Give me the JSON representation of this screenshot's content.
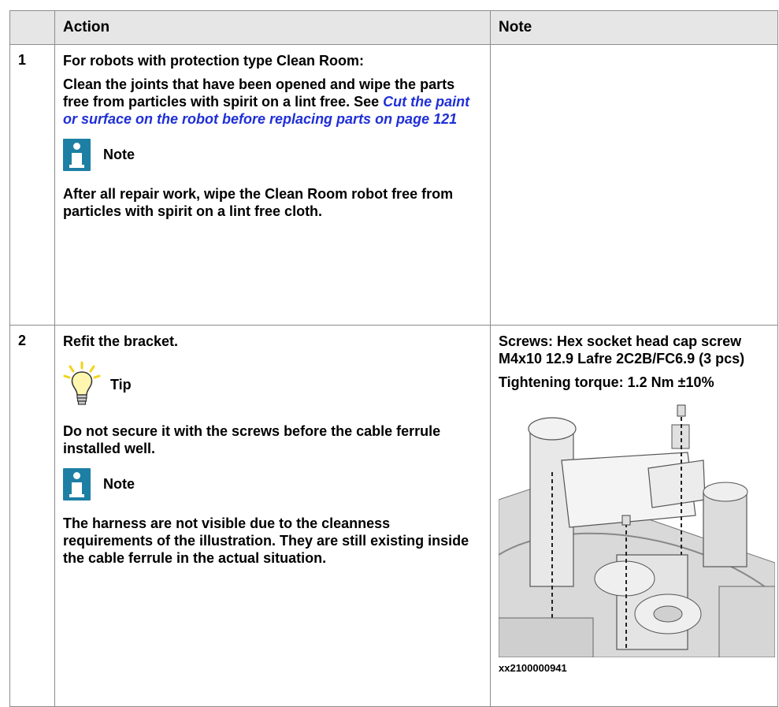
{
  "table": {
    "headers": {
      "number": "",
      "action": "Action",
      "note": "Note"
    },
    "rows": [
      {
        "number": "1",
        "action_title": "For robots with protection type Clean Room:",
        "action_text": "Clean the joints that have been opened and wipe the parts free from particles with spirit on a lint free. See ",
        "action_link": "Cut the paint or surface on the robot before replacing parts on page 121",
        "note_label": "Note",
        "note_text": "After all repair work, wipe the Clean Room robot free from particles with spirit on a lint free cloth."
      },
      {
        "number": "2",
        "action_title": "Refit the bracket.",
        "tip_label": "Tip",
        "tip_text": "Do not secure it with the screws before the cable ferrule installed well.",
        "note_label": "Note",
        "note_text": "The harness are not visible due to the cleanness requirements of the illustration. They are still existing inside the cable ferrule in the actual situation.",
        "screws": "Screws: Hex socket head cap screw M4x10 12.9 Lafre 2C2B/FC6.9 (3 pcs)",
        "torque": "Tightening torque: 1.2 Nm ±10%",
        "figure_caption": "xx2100000941"
      }
    ]
  },
  "colors": {
    "header_bg": "#e6e6e6",
    "link": "#1f2fd6",
    "note_icon": "#1d7fa4",
    "tip_bulb": "#f2d31b"
  },
  "icons": [
    "note-info-icon",
    "tip-lightbulb-icon"
  ]
}
